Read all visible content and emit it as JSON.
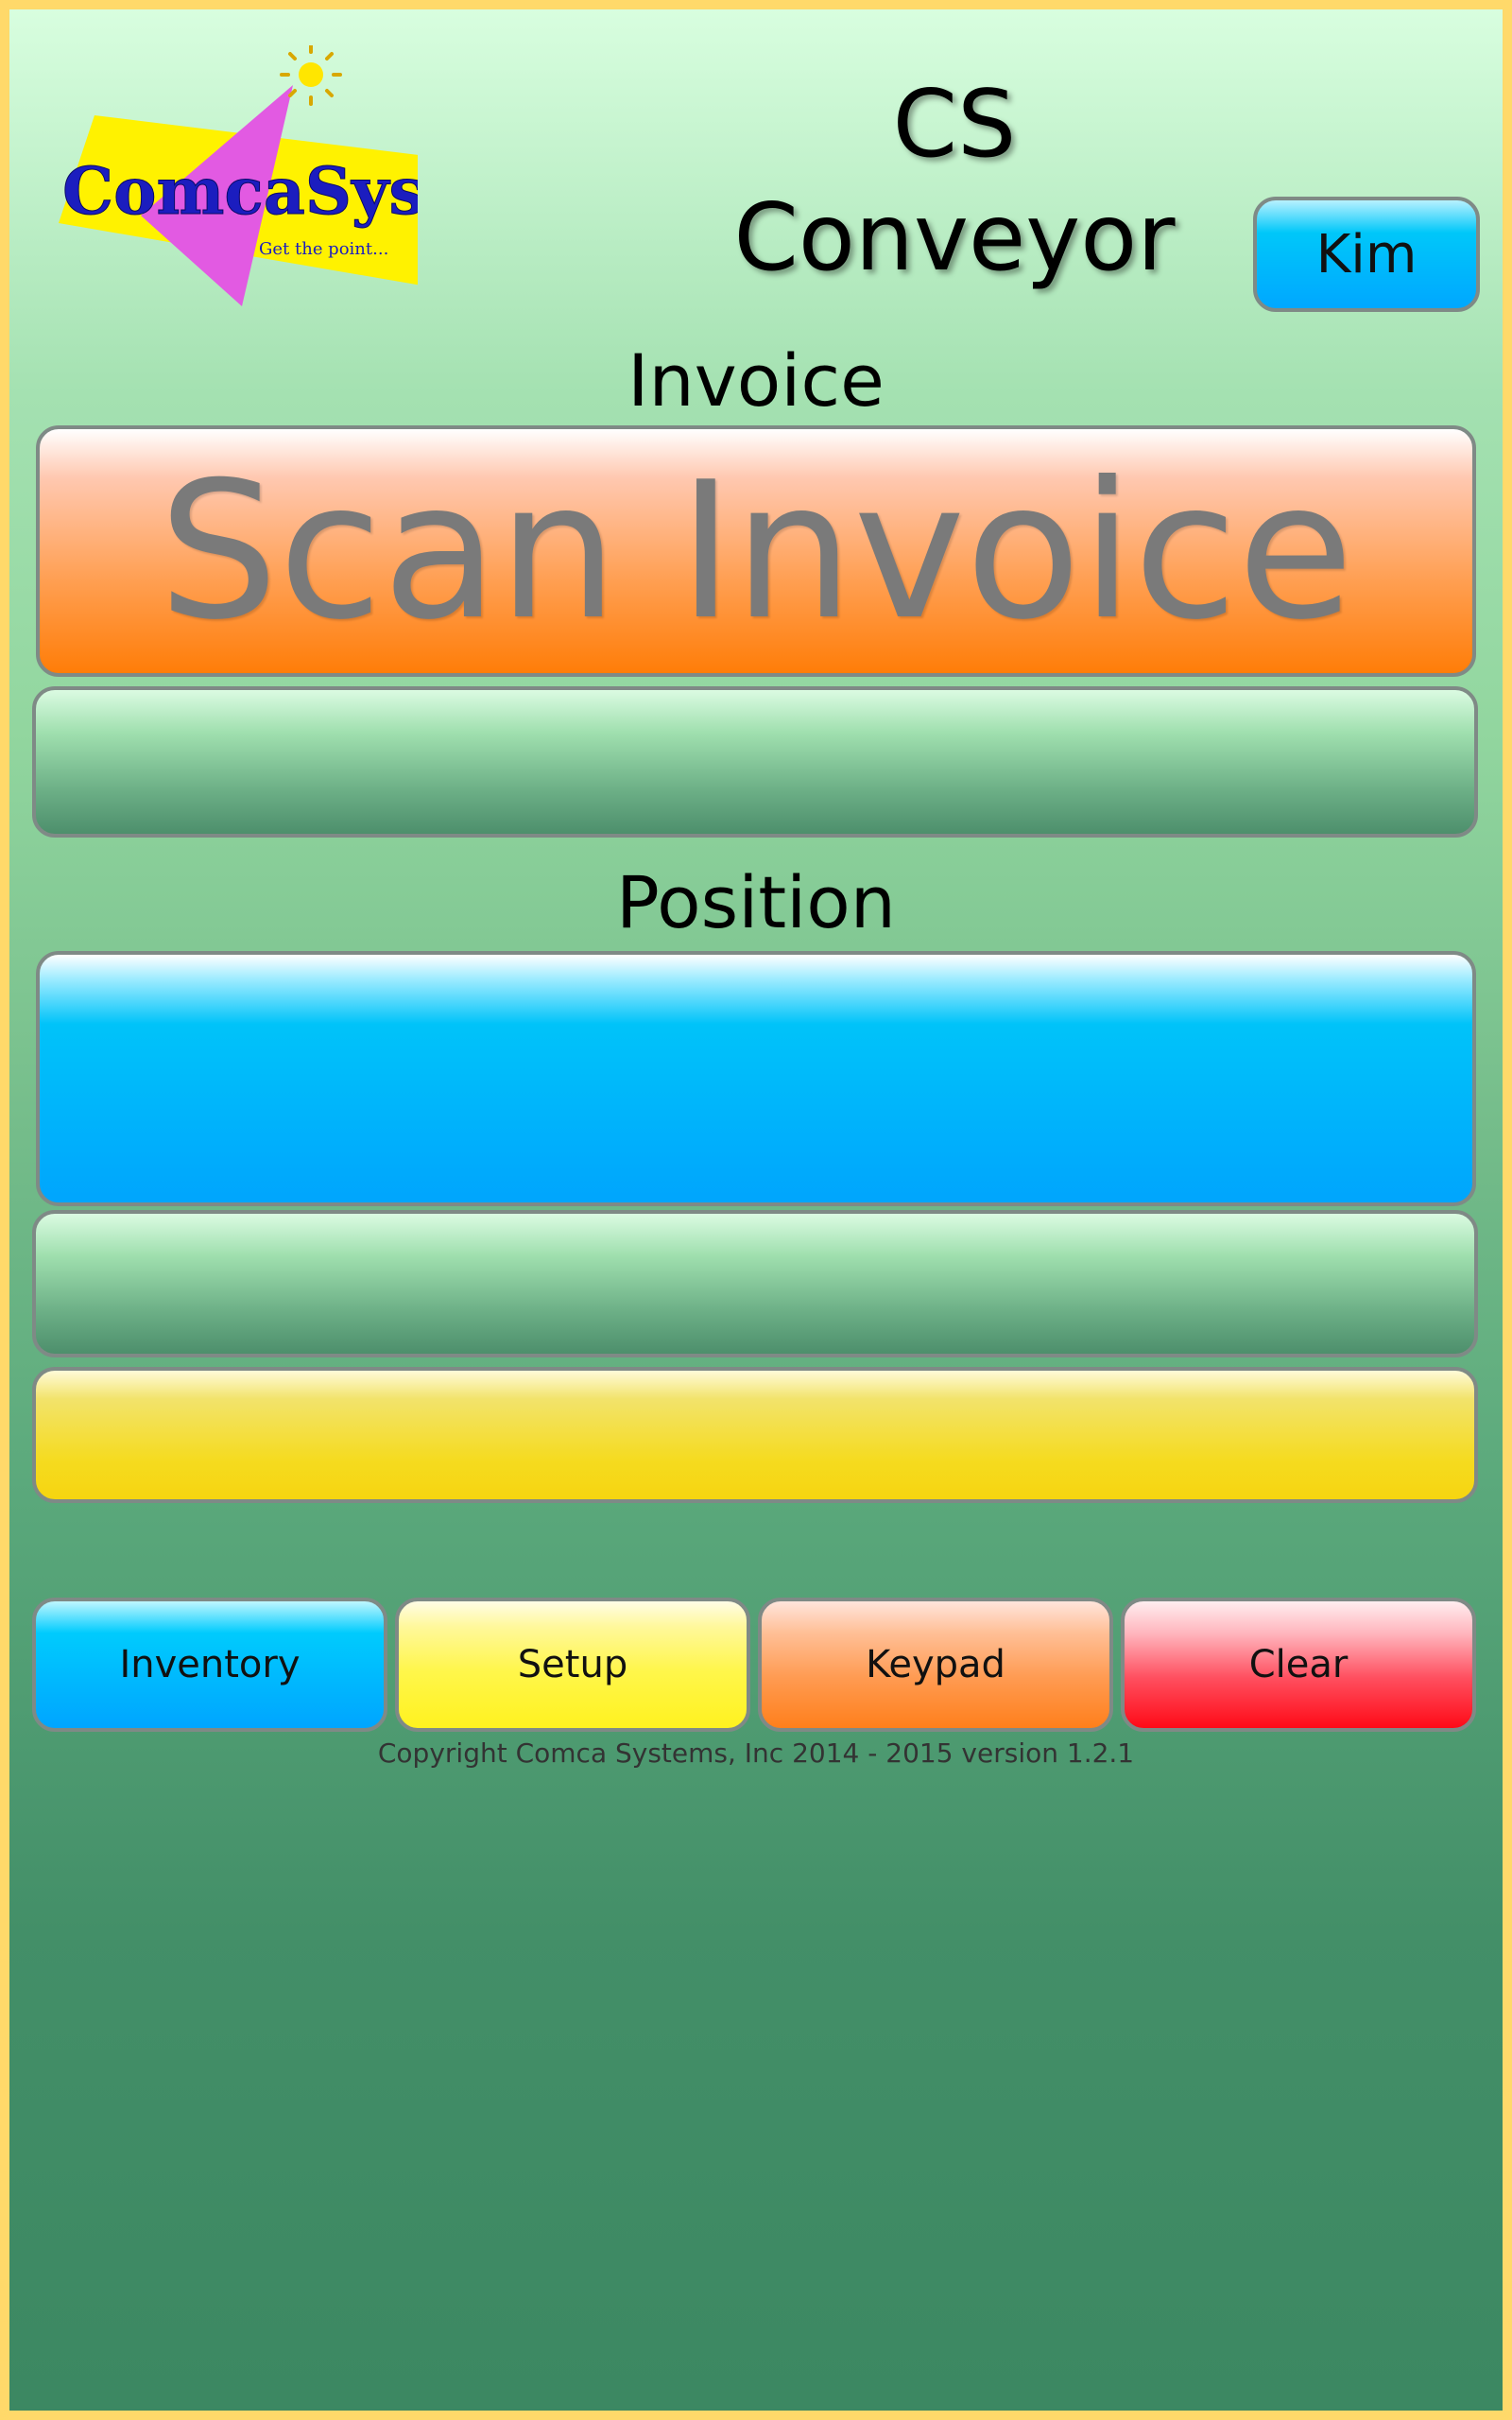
{
  "header": {
    "app_title": "CS Conveyor",
    "user_button": "Kim",
    "logo": {
      "brand_text": "ComcaSystems",
      "tagline": "Get the point..."
    }
  },
  "invoice": {
    "section_label": "Invoice",
    "scan_button_label": "Scan Invoice",
    "detail_value": ""
  },
  "position": {
    "section_label": "Position",
    "button_value": "",
    "detail_value": "",
    "status_value": ""
  },
  "actions": {
    "inventory_label": "Inventory",
    "setup_label": "Setup",
    "keypad_label": "Keypad",
    "clear_label": "Clear"
  },
  "footer": {
    "copyright": "Copyright Comca Systems, Inc 2014 - 2015 version 1.2.1"
  },
  "colors": {
    "frame_border": "#ffd96a",
    "background_top": "#d8fedf",
    "background_bottom": "#3c8862",
    "orange_accent": "#ff7d08",
    "blue_accent": "#00a5ff",
    "yellow_accent": "#f6d510",
    "red_accent": "#ff0a17"
  },
  "icons": {
    "logo": "comca-systems-logo"
  }
}
